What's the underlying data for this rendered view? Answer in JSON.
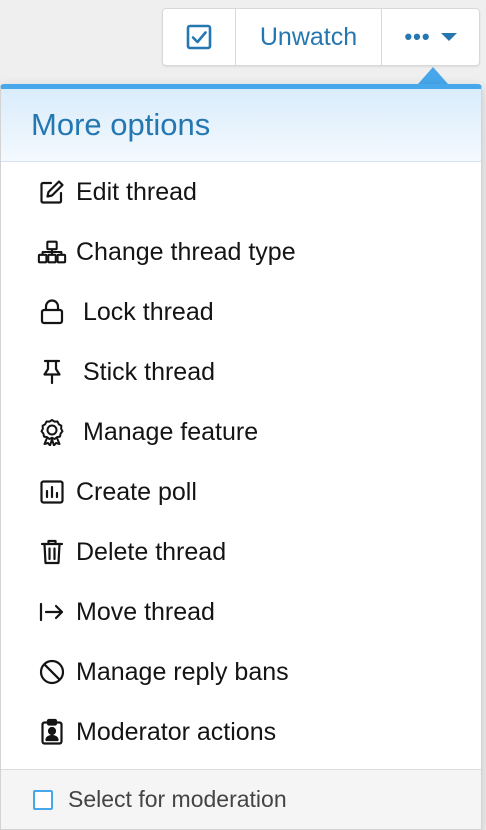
{
  "toolbar": {
    "check_icon": "checkbox-checked-icon",
    "unwatch_label": "Unwatch",
    "more_dots": "•••",
    "accent_color": "#2577b1"
  },
  "menu": {
    "title": "More options",
    "items": [
      {
        "label": "Edit thread",
        "icon": "edit-icon"
      },
      {
        "label": "Change thread type",
        "icon": "sitemap-icon"
      },
      {
        "label": "Lock thread",
        "icon": "lock-icon"
      },
      {
        "label": "Stick thread",
        "icon": "thumbtack-icon"
      },
      {
        "label": "Manage feature",
        "icon": "award-icon"
      },
      {
        "label": "Create poll",
        "icon": "poll-icon"
      },
      {
        "label": "Delete thread",
        "icon": "trash-icon"
      },
      {
        "label": "Move thread",
        "icon": "move-arrow-icon"
      },
      {
        "label": "Manage reply bans",
        "icon": "ban-icon"
      },
      {
        "label": "Moderator actions",
        "icon": "clipboard-user-icon"
      }
    ],
    "footer": {
      "label": "Select for moderation",
      "checked": false
    },
    "border_color": "#47a7eb"
  }
}
